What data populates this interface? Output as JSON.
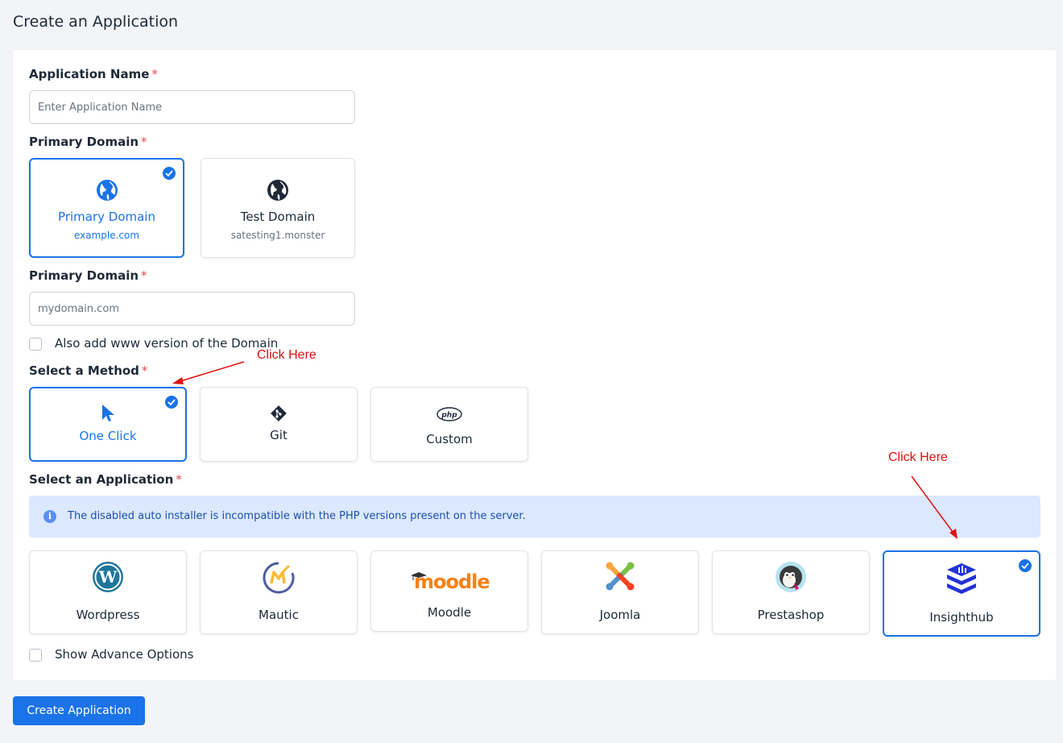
{
  "page": {
    "title": "Create an Application"
  },
  "form": {
    "app_name": {
      "label": "Application Name",
      "required": "*",
      "placeholder": "Enter Application Name",
      "value": ""
    },
    "domain_type": {
      "label": "Primary Domain",
      "required": "*",
      "options": [
        {
          "name": "Primary Domain",
          "sub": "example.com",
          "icon": "globe-icon",
          "selected": true
        },
        {
          "name": "Test Domain",
          "sub": "satesting1.monster",
          "icon": "globe-icon",
          "selected": false
        }
      ]
    },
    "domain": {
      "label": "Primary Domain",
      "required": "*",
      "placeholder": "mydomain.com",
      "value": ""
    },
    "www_checkbox": {
      "label": "Also add www version of the Domain",
      "checked": false
    },
    "method": {
      "label": "Select a Method",
      "required": "*",
      "options": [
        {
          "name": "One Click",
          "icon": "cursor-icon",
          "selected": true
        },
        {
          "name": "Git",
          "icon": "git-icon",
          "selected": false
        },
        {
          "name": "Custom",
          "icon": "php-icon",
          "selected": false
        }
      ]
    },
    "application": {
      "label": "Select an Application",
      "required": "*",
      "alert": "The disabled auto installer is incompatible with the PHP versions present on the server.",
      "options": [
        {
          "name": "Wordpress",
          "icon": "wordpress-icon",
          "selected": false
        },
        {
          "name": "Mautic",
          "icon": "mautic-icon",
          "selected": false
        },
        {
          "name": "Moodle",
          "icon": "moodle-logo",
          "selected": false
        },
        {
          "name": "Joomla",
          "icon": "joomla-icon",
          "selected": false
        },
        {
          "name": "Prestashop",
          "icon": "prestashop-icon",
          "selected": false
        },
        {
          "name": "Insighthub",
          "icon": "insighthub-icon",
          "selected": true
        }
      ]
    },
    "advance_checkbox": {
      "label": "Show Advance Options",
      "checked": false
    }
  },
  "annotations": {
    "first": "Click Here",
    "second": "Click Here"
  },
  "actions": {
    "submit_label": "Create Application"
  },
  "colors": {
    "accent": "#1a73e8",
    "required": "#e5484d",
    "annotation": "#e01010",
    "alert_bg": "#dbe8fd"
  }
}
